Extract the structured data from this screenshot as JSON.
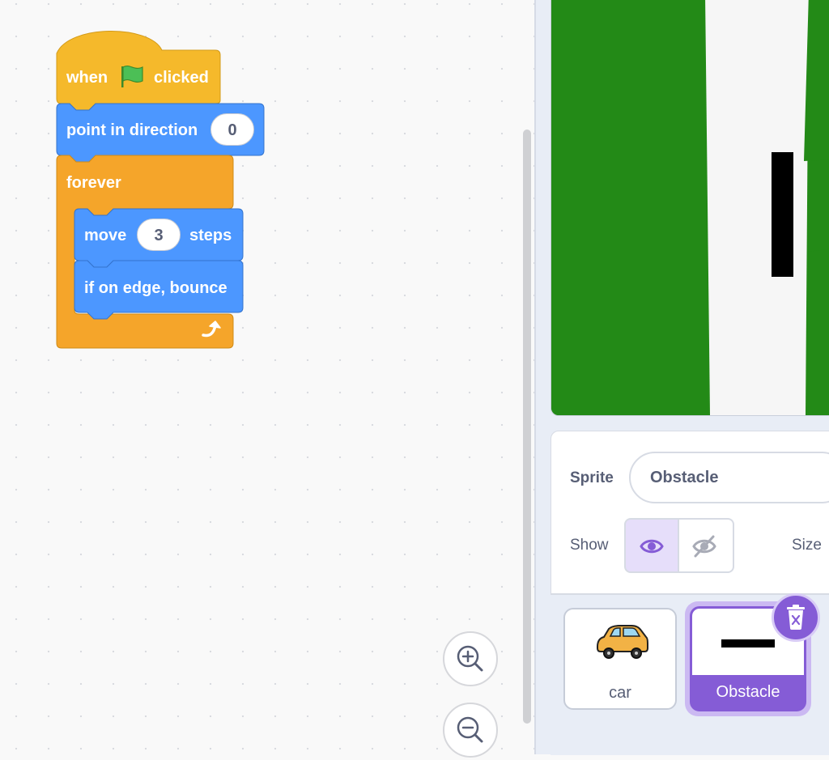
{
  "code_area": {
    "hat_block": {
      "prefix": "when",
      "flag_icon": "green-flag-icon",
      "suffix": "clicked"
    },
    "direction_block": {
      "label": "point in direction",
      "value": "0"
    },
    "forever_block": {
      "label": "forever",
      "loop_icon": "loop-arrow-icon"
    },
    "move_block": {
      "prefix": "move",
      "value": "3",
      "suffix": "steps"
    },
    "bounce_block": {
      "label": "if on edge, bounce"
    },
    "zoom_in_icon": "zoom-in-icon",
    "zoom_out_icon": "zoom-out-icon"
  },
  "sprite_info": {
    "sprite_label": "Sprite",
    "sprite_name_value": "Obstacle",
    "show_label": "Show",
    "size_label": "Size",
    "show_visible_icon": "eye-icon",
    "show_hidden_icon": "eye-slash-icon",
    "show_state": "visible"
  },
  "sprite_list": {
    "sprites": [
      {
        "name": "car",
        "selected": false,
        "thumb_icon": "car-icon"
      },
      {
        "name": "Obstacle",
        "selected": true,
        "thumb_icon": "black-bar-icon"
      }
    ],
    "delete_icon": "trash-icon"
  },
  "colors": {
    "events_yellow": "#FFBF00",
    "motion_blue": "#4C97FF",
    "control_orange": "#FFAB19",
    "stage_green": "#238A17",
    "selected_purple": "#855CD6"
  }
}
